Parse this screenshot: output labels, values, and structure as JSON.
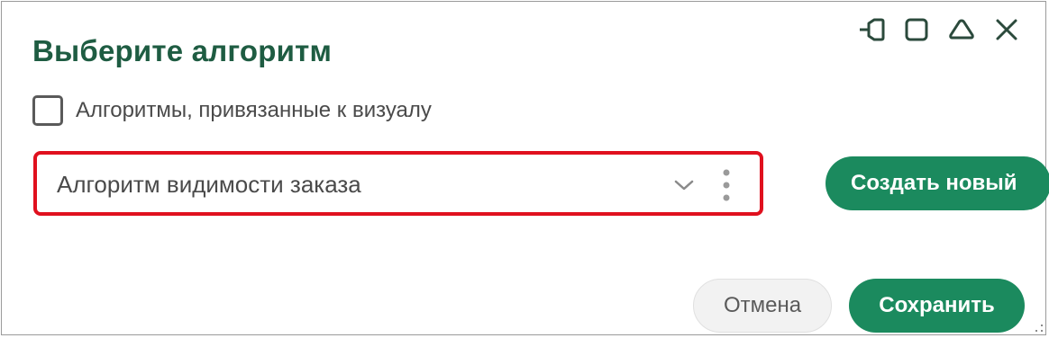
{
  "dialog": {
    "title": "Выберите алгоритм",
    "window_controls": [
      {
        "icon": "pin-icon"
      },
      {
        "icon": "maximize-icon"
      },
      {
        "icon": "collapse-icon"
      },
      {
        "icon": "close-icon"
      }
    ]
  },
  "checkbox": {
    "label": "Алгоритмы, привязанные к визуалу",
    "checked": false
  },
  "select": {
    "value": "Алгоритм видимости заказа",
    "highlight_color": "#e0101e"
  },
  "buttons": {
    "create_new": "Создать новый",
    "cancel": "Отмена",
    "save": "Сохранить"
  },
  "colors": {
    "title": "#1e5c42",
    "primary": "#1b8a5e",
    "icon": "#2b4a3c"
  }
}
